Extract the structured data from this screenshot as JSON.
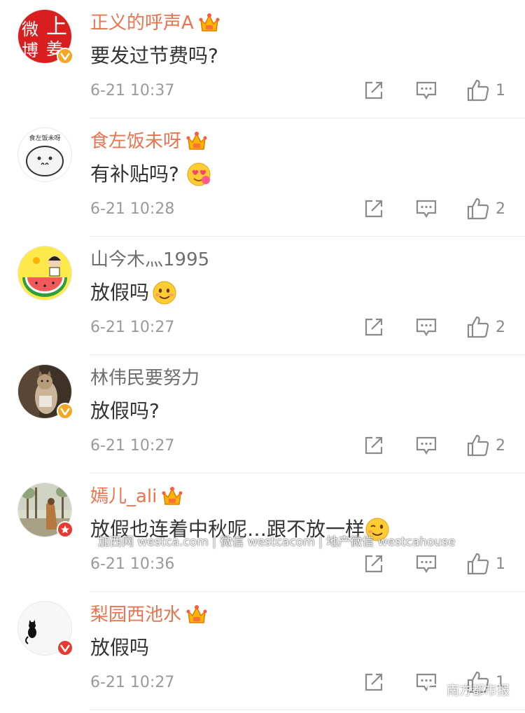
{
  "comments": [
    {
      "username": "正义的呼声A",
      "content": "要发过节费吗?",
      "time": "6-21 10:37",
      "likes": "1",
      "vip": true,
      "badge": "gold"
    },
    {
      "username": "食左饭未呀",
      "content": "有补贴吗?",
      "time": "6-21 10:28",
      "likes": "2",
      "vip": true,
      "badge": "none",
      "emoji": "heart-eyes-emoji"
    },
    {
      "username": "山今木灬1995",
      "content": "放假吗",
      "time": "6-21 10:27",
      "likes": "2",
      "vip": false,
      "badge": "none",
      "emoji": "smile-emoji"
    },
    {
      "username": "林伟民要努力",
      "content": "放假吗?",
      "time": "6-21 10:27",
      "likes": "2",
      "vip": false,
      "badge": "gold"
    },
    {
      "username": "嫣儿_ali",
      "content": "放假也连着中秋呢…跟不放一样",
      "time": "6-21 10:36",
      "likes": "1",
      "vip": true,
      "badge": "red-star",
      "emoji": "wink-emoji"
    },
    {
      "username": "梨园西池水",
      "content": "放假吗",
      "time": "6-21 10:27",
      "likes": "1",
      "vip": true,
      "badge": "red-v"
    }
  ],
  "avatar1_text": [
    "微",
    "上",
    "博",
    "姜"
  ],
  "avatar2_text": "食左饭未呀",
  "watermark": "加西网 westca.com | 微信 westcacom | 地产微信 westcahouse",
  "brand": "南方都市报",
  "colors": {
    "vip_name": "#eb7350",
    "normal_name": "#6e6e6e",
    "text": "#333333",
    "meta": "#9a9a9a"
  }
}
